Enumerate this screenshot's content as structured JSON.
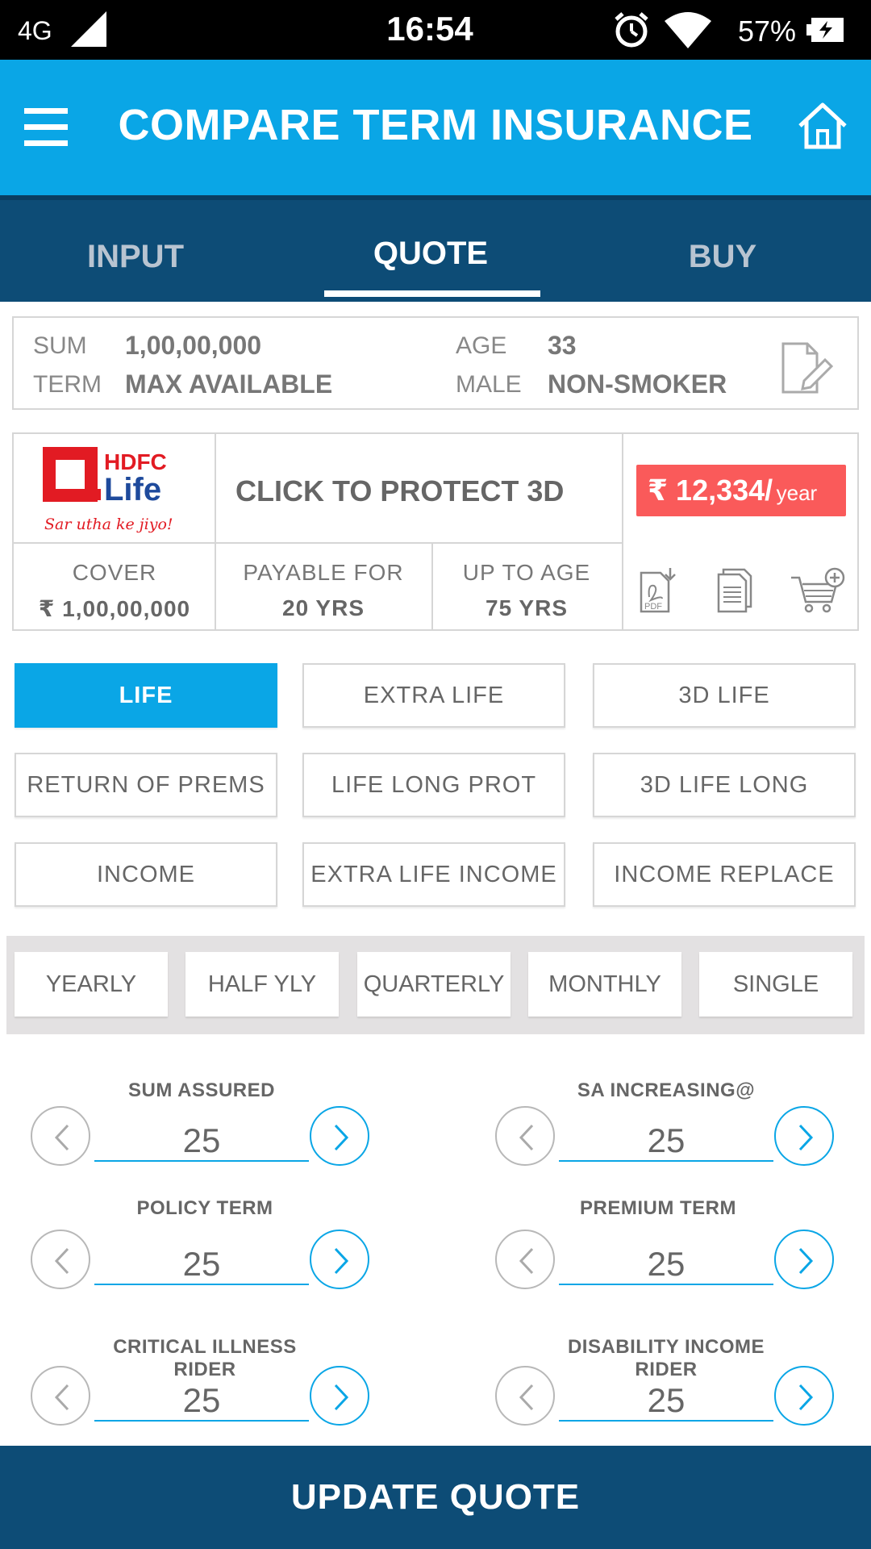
{
  "status_bar": {
    "network": "4G",
    "time": "16:54",
    "battery_pct": "57%",
    "icons": [
      "signal-icon",
      "alarm-icon",
      "wifi-icon",
      "battery-charging-icon"
    ]
  },
  "app_bar": {
    "title": "COMPARE TERM INSURANCE",
    "icons": [
      "menu-icon",
      "home-icon"
    ]
  },
  "tabs": [
    {
      "label": "INPUT",
      "active": false
    },
    {
      "label": "QUOTE",
      "active": true
    },
    {
      "label": "BUY",
      "active": false
    }
  ],
  "summary": {
    "sum_label": "SUM",
    "sum_value": "1,00,00,000",
    "term_label": "TERM",
    "term_value": "MAX AVAILABLE",
    "age_label": "AGE",
    "age_value": "33",
    "gender_label": "MALE",
    "smoker_value": "NON-SMOKER",
    "edit_icon": "edit-document-icon"
  },
  "product": {
    "insurer_logo_text": "HDFC",
    "insurer_logo_text2": "Life",
    "insurer_tagline": "Sar utha ke jiyo!",
    "name": "CLICK TO PROTECT 3D",
    "premium_amount": "₹ 12,334/",
    "premium_period": "year",
    "cover_label": "COVER",
    "cover_value": "₹ 1,00,00,000",
    "payable_label": "PAYABLE FOR",
    "payable_value": "20 YRS",
    "upto_label": "UP TO AGE",
    "upto_value": "75 YRS",
    "actions": [
      "pdf-download-icon",
      "documents-icon",
      "add-to-cart-icon"
    ]
  },
  "plans": [
    {
      "label": "LIFE",
      "active": true
    },
    {
      "label": "EXTRA LIFE",
      "active": false
    },
    {
      "label": "3D LIFE",
      "active": false
    },
    {
      "label": "RETURN OF PREMS",
      "active": false
    },
    {
      "label": "LIFE LONG PROT",
      "active": false
    },
    {
      "label": "3D LIFE LONG",
      "active": false
    },
    {
      "label": "INCOME",
      "active": false
    },
    {
      "label": "EXTRA LIFE INCOME",
      "active": false
    },
    {
      "label": "INCOME REPLACE",
      "active": false
    }
  ],
  "frequencies": [
    "YEARLY",
    "HALF YLY",
    "QUARTERLY",
    "MONTHLY",
    "SINGLE"
  ],
  "steppers": [
    {
      "label": "SUM ASSURED",
      "value": "25"
    },
    {
      "label": "SA INCREASING@",
      "value": "25"
    },
    {
      "label": "POLICY TERM",
      "value": "25"
    },
    {
      "label": "PREMIUM TERM",
      "value": "25"
    },
    {
      "label": "CRITICAL ILLNESS RIDER",
      "value": "25"
    },
    {
      "label": "DISABILITY INCOME RIDER",
      "value": "25"
    }
  ],
  "update_button": "UPDATE QUOTE",
  "colors": {
    "primary": "#0aa6e6",
    "dark": "#0d4c76",
    "price": "#fa5a5a",
    "logo_red": "#e21b23",
    "logo_blue": "#1e4a9c"
  }
}
